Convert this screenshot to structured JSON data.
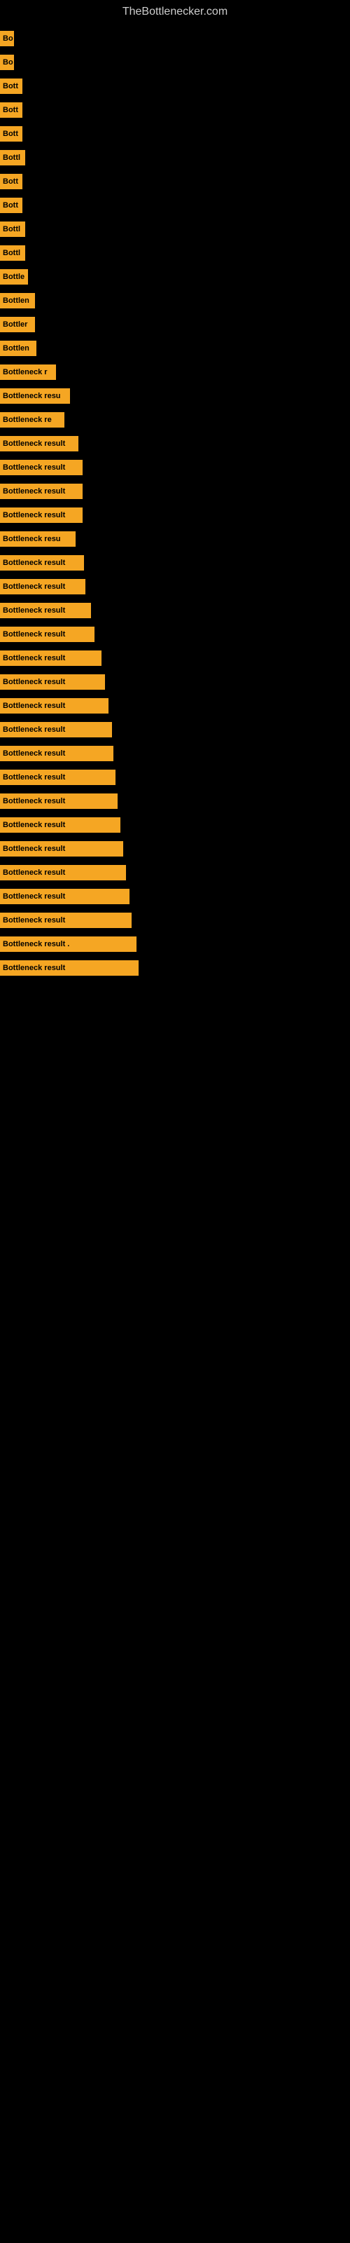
{
  "site_title": "TheBottlenecker.com",
  "bars": [
    {
      "label": "Bo",
      "width": 20
    },
    {
      "label": "Bo",
      "width": 20
    },
    {
      "label": "Bott",
      "width": 32
    },
    {
      "label": "Bott",
      "width": 32
    },
    {
      "label": "Bott",
      "width": 32
    },
    {
      "label": "Bottl",
      "width": 36
    },
    {
      "label": "Bott",
      "width": 32
    },
    {
      "label": "Bott",
      "width": 32
    },
    {
      "label": "Bottl",
      "width": 36
    },
    {
      "label": "Bottl",
      "width": 36
    },
    {
      "label": "Bottle",
      "width": 40
    },
    {
      "label": "Bottlen",
      "width": 50
    },
    {
      "label": "Bottler",
      "width": 50
    },
    {
      "label": "Bottlen",
      "width": 52
    },
    {
      "label": "Bottleneck r",
      "width": 80
    },
    {
      "label": "Bottleneck resu",
      "width": 100
    },
    {
      "label": "Bottleneck re",
      "width": 92
    },
    {
      "label": "Bottleneck result",
      "width": 112
    },
    {
      "label": "Bottleneck result",
      "width": 118
    },
    {
      "label": "Bottleneck result",
      "width": 118
    },
    {
      "label": "Bottleneck result",
      "width": 118
    },
    {
      "label": "Bottleneck resu",
      "width": 108
    },
    {
      "label": "Bottleneck result",
      "width": 120
    },
    {
      "label": "Bottleneck result",
      "width": 122
    },
    {
      "label": "Bottleneck result",
      "width": 130
    },
    {
      "label": "Bottleneck result",
      "width": 135
    },
    {
      "label": "Bottleneck result",
      "width": 145
    },
    {
      "label": "Bottleneck result",
      "width": 150
    },
    {
      "label": "Bottleneck result",
      "width": 155
    },
    {
      "label": "Bottleneck result",
      "width": 160
    },
    {
      "label": "Bottleneck result",
      "width": 162
    },
    {
      "label": "Bottleneck result",
      "width": 165
    },
    {
      "label": "Bottleneck result",
      "width": 168
    },
    {
      "label": "Bottleneck result",
      "width": 172
    },
    {
      "label": "Bottleneck result",
      "width": 176
    },
    {
      "label": "Bottleneck result",
      "width": 180
    },
    {
      "label": "Bottleneck result",
      "width": 185
    },
    {
      "label": "Bottleneck result",
      "width": 188
    },
    {
      "label": "Bottleneck result .",
      "width": 195
    },
    {
      "label": "Bottleneck result",
      "width": 198
    }
  ]
}
